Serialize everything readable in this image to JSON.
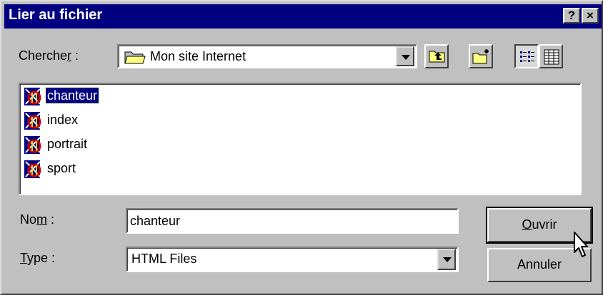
{
  "dialog": {
    "title": "Lier au fichier",
    "help_button": "?",
    "close_button": "×"
  },
  "lookin": {
    "label_before": "Cherche",
    "label_accel": "r",
    "label_after": " :",
    "value": "Mon site Internet",
    "icon": "folder-icon"
  },
  "toolbar": {
    "up_icon": "up-one-level-icon",
    "newfolder_icon": "new-folder-icon",
    "list_icon": "list-view-icon",
    "details_icon": "details-view-icon"
  },
  "files": [
    {
      "name": "chanteur",
      "selected": true,
      "icon": "html-file-icon"
    },
    {
      "name": "index",
      "selected": false,
      "icon": "html-file-icon"
    },
    {
      "name": "portrait",
      "selected": false,
      "icon": "html-file-icon"
    },
    {
      "name": "sport",
      "selected": false,
      "icon": "html-file-icon"
    }
  ],
  "name_field": {
    "label_before": "No",
    "label_accel": "m",
    "label_after": " :",
    "value": "chanteur"
  },
  "type_field": {
    "label_accel": "T",
    "label_after": "ype :",
    "value": "HTML Files"
  },
  "buttons": {
    "open_accel": "O",
    "open_rest": "uvrir",
    "cancel": "Annuler"
  },
  "colors": {
    "titlebar": "#000080",
    "face": "#c0c0c0",
    "selection": "#000080"
  }
}
